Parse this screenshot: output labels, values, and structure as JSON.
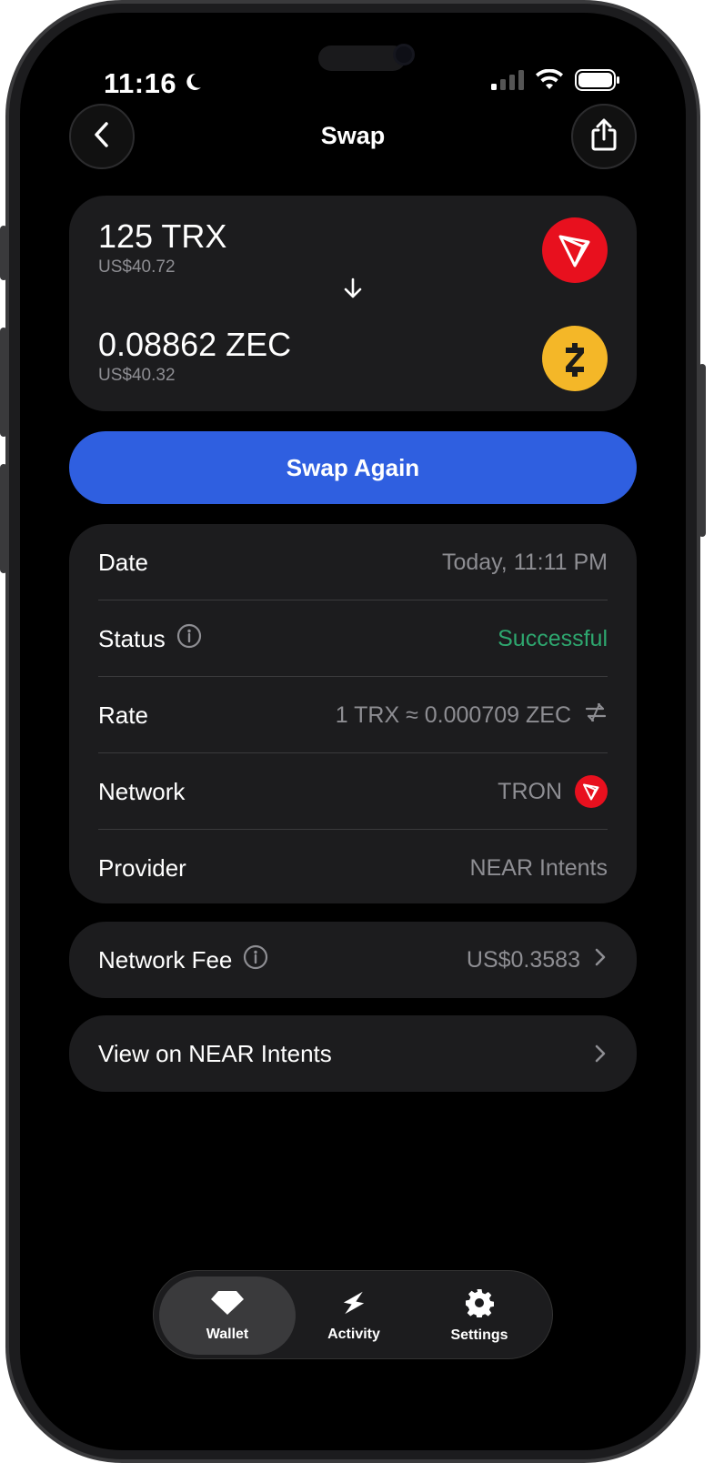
{
  "status_bar": {
    "time": "11:16"
  },
  "nav": {
    "title": "Swap"
  },
  "swap": {
    "from": {
      "amount": "125 TRX",
      "usd": "US$40.72",
      "icon": "tron-icon"
    },
    "to": {
      "amount": "0.08862 ZEC",
      "usd": "US$40.32",
      "icon": "zcash-icon"
    }
  },
  "swap_again_label": "Swap Again",
  "details": {
    "date": {
      "label": "Date",
      "value": "Today, 11:11 PM"
    },
    "status": {
      "label": "Status",
      "value": "Successful"
    },
    "rate": {
      "label": "Rate",
      "value": "1 TRX ≈ 0.000709 ZEC"
    },
    "network": {
      "label": "Network",
      "value": "TRON"
    },
    "provider": {
      "label": "Provider",
      "value": "NEAR Intents"
    }
  },
  "fee": {
    "label": "Network Fee",
    "value": "US$0.3583"
  },
  "explorer": {
    "label": "View on NEAR Intents"
  },
  "tabbar": {
    "wallet": "Wallet",
    "activity": "Activity",
    "settings": "Settings"
  },
  "colors": {
    "accent": "#2f5fe0",
    "success": "#2ea76f",
    "tron": "#e8101e",
    "zcash": "#f4b728"
  }
}
